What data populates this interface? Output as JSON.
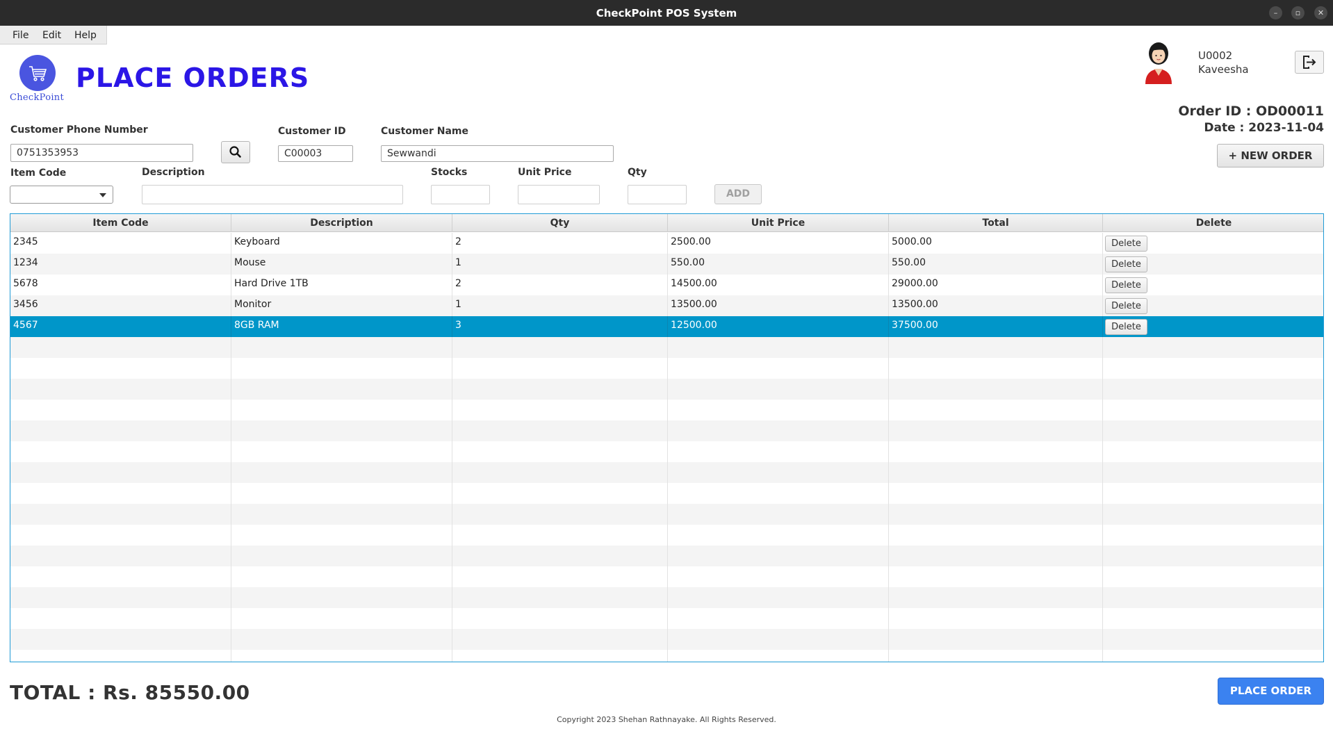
{
  "window": {
    "title": "CheckPoint POS System"
  },
  "menu": [
    "File",
    "Edit",
    "Help"
  ],
  "header": {
    "logo_text": "CheckPoint",
    "page_title": "PLACE ORDERS",
    "user_id": "U0002",
    "user_name": "Kaveesha",
    "order_id": "Order ID : OD00011",
    "order_date": "Date : 2023-11-04",
    "new_order_label": "+ NEW ORDER"
  },
  "form": {
    "phone_label": "Customer Phone Number",
    "phone_value": "0751353953",
    "customer_id_label": "Customer ID",
    "customer_id_value": "C00003",
    "customer_name_label": "Customer Name",
    "customer_name_value": "Sewwandi",
    "item_code_label": "Item Code",
    "item_code_value": "",
    "description_label": "Description",
    "description_value": "",
    "stocks_label": "Stocks",
    "stocks_value": "",
    "unit_price_label": "Unit Price",
    "unit_price_value": "",
    "qty_label": "Qty",
    "qty_value": "",
    "add_label": "ADD"
  },
  "table": {
    "columns": [
      "Item Code",
      "Description",
      "Qty",
      "Unit Price",
      "Total",
      "Delete"
    ],
    "rows": [
      {
        "code": "2345",
        "description": "Keyboard",
        "qty": "2",
        "unit_price": "2500.00",
        "total": "5000.00",
        "delete": "Delete"
      },
      {
        "code": "1234",
        "description": "Mouse",
        "qty": "1",
        "unit_price": "550.00",
        "total": "550.00",
        "delete": "Delete"
      },
      {
        "code": "5678",
        "description": "Hard Drive 1TB",
        "qty": "2",
        "unit_price": "14500.00",
        "total": "29000.00",
        "delete": "Delete"
      },
      {
        "code": "3456",
        "description": "Monitor",
        "qty": "1",
        "unit_price": "13500.00",
        "total": "13500.00",
        "delete": "Delete"
      },
      {
        "code": "4567",
        "description": "8GB RAM",
        "qty": "3",
        "unit_price": "12500.00",
        "total": "37500.00",
        "delete": "Delete"
      }
    ],
    "selected_row": 4,
    "empty_rows": 19
  },
  "footer": {
    "total": "TOTAL : Rs. 85550.00",
    "place_order_label": "PLACE ORDER",
    "copyright": "Copyright 2023 Shehan Rathnayake. All Rights Reserved."
  },
  "colors": {
    "title_blue": "#2b16e6",
    "selected_row": "#0096c9",
    "table_border": "#1f9bd6",
    "place_order": "#3b82f0"
  },
  "icons": {
    "search": "search-icon",
    "logout": "logout-icon",
    "cart": "cart-icon",
    "avatar": "user-avatar"
  }
}
